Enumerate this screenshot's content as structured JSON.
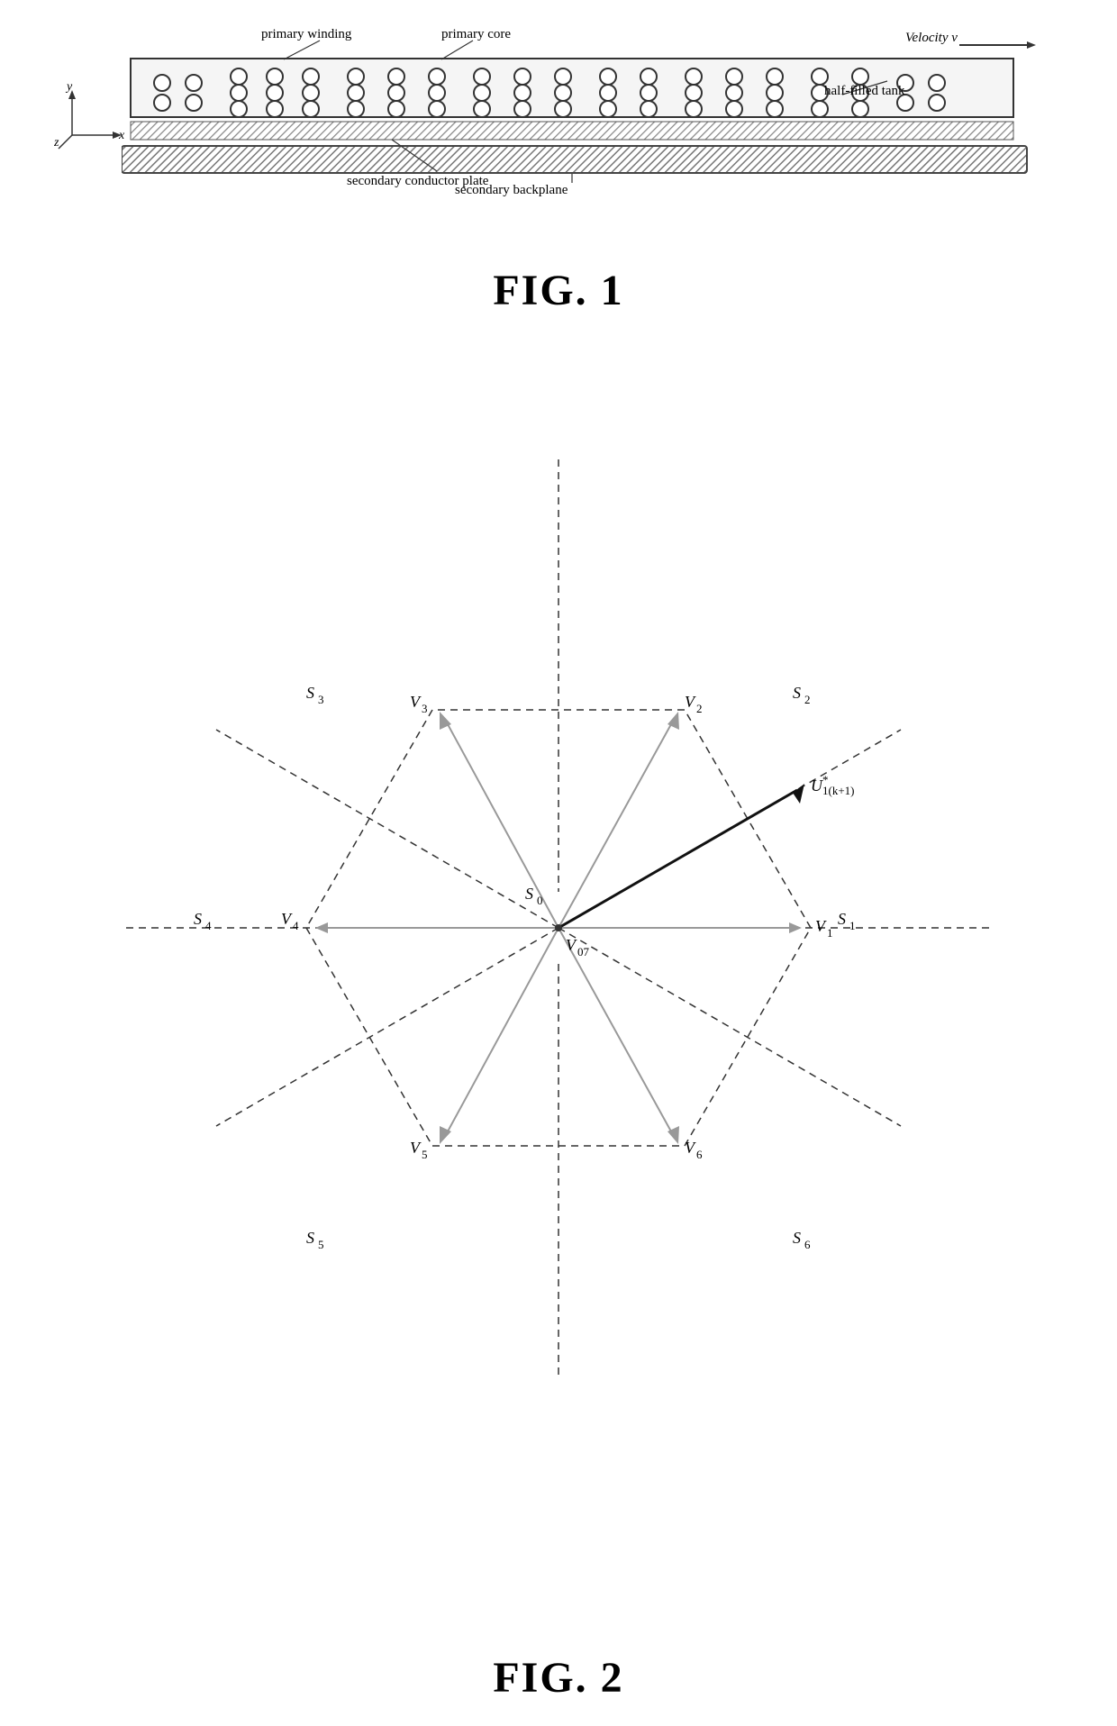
{
  "fig1": {
    "title": "FIG. 1",
    "labels": {
      "primary_winding": "primary winding",
      "primary_core": "primary core",
      "secondary_conductor": "secondary conductor plate",
      "half_filled_tank": "half-filled tank",
      "secondary_backplane": "secondary backplane",
      "velocity": "Velocity v"
    },
    "axes": {
      "y": "y",
      "z": "z",
      "x": "x"
    }
  },
  "fig2": {
    "title": "FIG. 2",
    "vectors": {
      "V1": "V₁",
      "V2": "V₂",
      "V3": "V₃",
      "V4": "V₄",
      "V5": "V₅",
      "V6": "V₆",
      "V07": "V₀₇",
      "U_ref": "U*₁(k+1)"
    },
    "sectors": {
      "S0": "S₀",
      "S1": "S₁",
      "S2": "S₂",
      "S3": "S₃",
      "S4": "S₄",
      "S5": "S₅",
      "S6": "S₆"
    }
  }
}
